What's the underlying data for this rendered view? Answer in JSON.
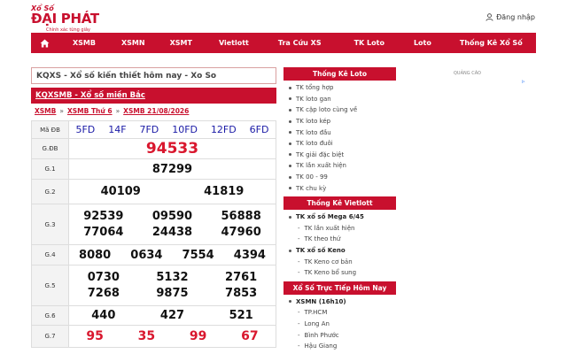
{
  "header": {
    "logo_small": "Xổ Số",
    "logo_brand": "ĐẠI PHÁT",
    "logo_tagline": "Chính xác từng giây",
    "login_label": "Đăng nhập"
  },
  "nav": {
    "items": [
      "XSMB",
      "XSMN",
      "XSMT",
      "Vietlott",
      "Tra Cứu XS",
      "TK Loto",
      "Loto",
      "Thống Kê Xổ Số"
    ]
  },
  "main": {
    "title": "KQXS - Xổ số kiến thiết hôm nay - Xo So",
    "section_title": "KQXSMB - Xổ số miền Bắc",
    "breadcrumb": [
      "XSMB",
      "XSMB Thứ 6",
      "XSMB 21/08/2026"
    ],
    "breadcrumb_sep": "»",
    "results": [
      {
        "label": "Mã ĐB",
        "values": [
          "5FD",
          "14F",
          "7FD",
          "10FD",
          "12FD",
          "6FD"
        ]
      },
      {
        "label": "G.ĐB",
        "values": [
          "94533"
        ]
      },
      {
        "label": "G.1",
        "values": [
          "87299"
        ]
      },
      {
        "label": "G.2",
        "values": [
          "40109",
          "41819"
        ]
      },
      {
        "label": "G.3",
        "values": [
          "92539",
          "09590",
          "56888",
          "77064",
          "24438",
          "47960"
        ]
      },
      {
        "label": "G.4",
        "values": [
          "8080",
          "0634",
          "7554",
          "4394"
        ]
      },
      {
        "label": "G.5",
        "values": [
          "0730",
          "5132",
          "2761",
          "7268",
          "9875",
          "7853"
        ]
      },
      {
        "label": "G.6",
        "values": [
          "440",
          "427",
          "521"
        ]
      },
      {
        "label": "G.7",
        "values": [
          "95",
          "35",
          "99",
          "67"
        ]
      }
    ]
  },
  "sidebar": {
    "loto_title": "Thống Kê Loto",
    "loto_items": [
      "TK tổng hợp",
      "TK loto gan",
      "TK cặp loto cùng về",
      "TK loto kép",
      "TK loto đầu",
      "TK loto đuôi",
      "TK giải đặc biệt",
      "TK lần xuất hiện",
      "TK 00 - 99",
      "TK chu kỳ"
    ],
    "vietlott_title": "Thống Kê Vietlott",
    "mega_label": "TK xổ số Mega 6/45",
    "mega_items": [
      "TK lần xuất hiện",
      "TK theo thứ"
    ],
    "keno_label": "TK xổ số Keno",
    "keno_items": [
      "TK Keno cơ bản",
      "TK Keno bổ sung"
    ],
    "live_title": "Xổ Số Trực Tiếp Hôm Nay",
    "xsmn_label": "XSMN (16h10)",
    "xsmn_items": [
      "TP.HCM",
      "Long An",
      "Bình Phước",
      "Hậu Giang"
    ]
  },
  "ad": {
    "label": "QUẢNG CÁO"
  }
}
